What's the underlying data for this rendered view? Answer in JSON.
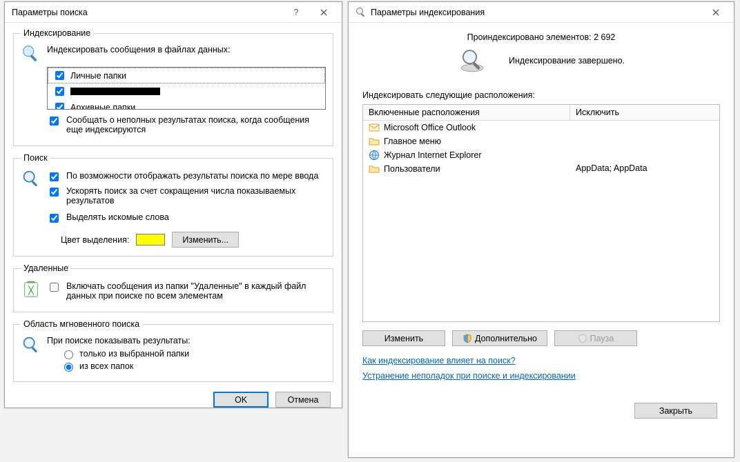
{
  "left": {
    "title": "Параметры поиска",
    "groups": {
      "indexing": {
        "legend": "Индексирование",
        "label": "Индексировать сообщения в файлах данных:",
        "items": [
          {
            "label": "Личные папки",
            "checked": true
          },
          {
            "label": "",
            "checked": true,
            "redacted": true
          },
          {
            "label": "Архивные папки",
            "checked": true
          }
        ],
        "notify": "Сообщать о неполных результатах поиска, когда сообщения еще индексируются"
      },
      "search": {
        "legend": "Поиск",
        "asYouType": "По возможности отображать результаты поиска по мере ввода",
        "speedUp": "Ускорять поиск за счет сокращения числа показываемых результатов",
        "highlight": "Выделять искомые слова",
        "colorLabel": "Цвет выделения:",
        "changeBtn": "Изменить..."
      },
      "deleted": {
        "legend": "Удаленные",
        "include": "Включать сообщения из папки \"Удаленные\" в каждый файл данных при поиске по всем элементам"
      },
      "scope": {
        "legend": "Область мгновенного поиска",
        "label": "При поиске показывать результаты:",
        "radio1": "только из выбранной папки",
        "radio2": "из всех папок"
      }
    },
    "ok": "OK",
    "cancel": "Отмена"
  },
  "right": {
    "title": "Параметры индексирования",
    "indexedLabel": "Проиндексировано элементов: 2 692",
    "statusLabel": "Индексирование завершено.",
    "locationsLabel": "Индексировать следующие расположения:",
    "columns": {
      "included": "Включенные расположения",
      "exclude": "Исключить"
    },
    "locations": [
      {
        "name": "Microsoft Office Outlook",
        "exclude": "",
        "icon": "outlook"
      },
      {
        "name": "Главное меню",
        "exclude": "",
        "icon": "folder"
      },
      {
        "name": "Журнал Internet Explorer",
        "exclude": "",
        "icon": "ie"
      },
      {
        "name": "Пользователи",
        "exclude": "AppData; AppData",
        "icon": "folder"
      }
    ],
    "buttons": {
      "modify": "Изменить",
      "advanced": "Дополнительно",
      "pause": "Пауза"
    },
    "links": {
      "how": "Как индексирование влияет на поиск?",
      "troubleshoot": "Устранение неполадок при поиске и индексировании"
    },
    "close": "Закрыть"
  }
}
